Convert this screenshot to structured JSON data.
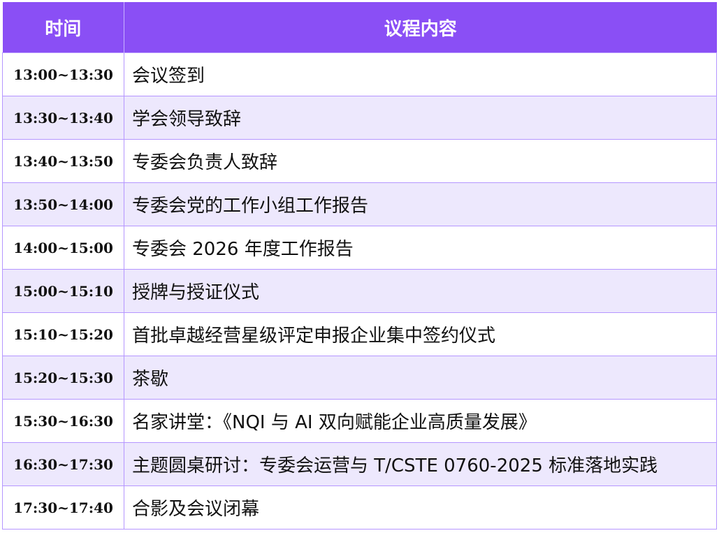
{
  "header": {
    "time": "时间",
    "content": "议程内容"
  },
  "rows": [
    {
      "time": "13:00~13:30",
      "item": "会议签到"
    },
    {
      "time": "13:30~13:40",
      "item": "学会领导致辞"
    },
    {
      "time": "13:40~13:50",
      "item": "专委会负责人致辞"
    },
    {
      "time": "13:50~14:00",
      "item": "专委会党的工作小组工作报告"
    },
    {
      "time": "14:00~15:00",
      "item": "专委会 2026 年度工作报告"
    },
    {
      "time": "15:00~15:10",
      "item": "授牌与授证仪式"
    },
    {
      "time": "15:10~15:20",
      "item": "首批卓越经营星级评定申报企业集中签约仪式"
    },
    {
      "time": "15:20~15:30",
      "item": "茶歇"
    },
    {
      "time": "15:30~16:30",
      "item": "名家讲堂：《NQI 与 AI 双向赋能企业高质量发展》"
    },
    {
      "time": "16:30~17:30",
      "item": "主题圆桌研讨：专委会运营与 T/CSTE 0760-2025 标准落地实践"
    },
    {
      "time": "17:30~17:40",
      "item": "合影及会议闭幕"
    }
  ],
  "colors": {
    "header_bg": "#8a4ff5",
    "stripe": "#ede8fd",
    "border": "#b596ff"
  }
}
